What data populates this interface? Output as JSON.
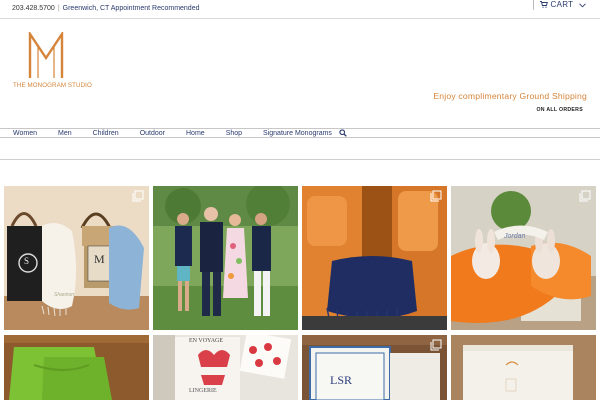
{
  "topbar": {
    "phone": "203.428.5700",
    "location": "Greenwich, CT Appointment Recommended",
    "cart_label": "CART"
  },
  "brand": {
    "logo_letter": "M",
    "name": "THE MONOGRAM STUDIO",
    "accent_color": "#d5843a"
  },
  "promo": {
    "headline": "Enjoy complimentary Ground Shipping",
    "subline": "ON ALL ORDERS"
  },
  "nav": {
    "items": [
      {
        "label": "Women"
      },
      {
        "label": "Men"
      },
      {
        "label": "Children"
      },
      {
        "label": "Outdoor"
      },
      {
        "label": "Home"
      },
      {
        "label": "Shop"
      },
      {
        "label": "Signature Monograms"
      }
    ],
    "search_icon": "search-icon"
  },
  "gallery": {
    "photos": [
      {
        "id": "totes",
        "overlay_icon": "multi-image-icon"
      },
      {
        "id": "family"
      },
      {
        "id": "car-throw",
        "overlay_icon": "multi-image-icon"
      },
      {
        "id": "bunnies",
        "overlay_icon": "multi-image-icon"
      },
      {
        "id": "green-napkins"
      },
      {
        "id": "lingerie"
      },
      {
        "id": "lsr-bag",
        "overlay_icon": "multi-image-icon"
      },
      {
        "id": "white-towel"
      }
    ],
    "text_tote_S": "S",
    "text_tote_M": "M",
    "text_scarf": "Shannon",
    "text_bunny": "Jordan",
    "text_bag": "LSR",
    "text_lingerie": "LINGERIE",
    "text_lingerie_top": "EN VOYAGE"
  }
}
